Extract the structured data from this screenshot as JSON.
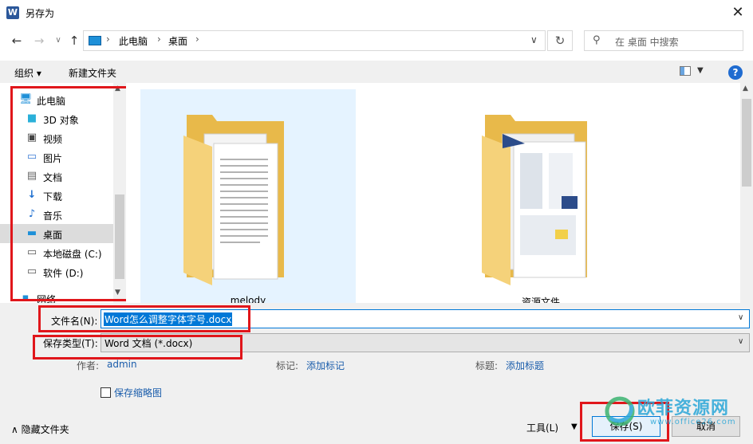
{
  "window": {
    "title": "另存为",
    "app_icon": "W",
    "close": "✕"
  },
  "nav": {
    "back": "←",
    "forward": "→",
    "recent": "∨",
    "up": "↑",
    "breadcrumbs": [
      "此电脑",
      "桌面"
    ],
    "refresh": "↻",
    "search_placeholder": "在 桌面 中搜索"
  },
  "toolbar": {
    "organize": "组织 ▾",
    "new_folder": "新建文件夹",
    "help": "?"
  },
  "sidebar": {
    "items": [
      {
        "label": "此电脑",
        "icon": "computer-icon"
      },
      {
        "label": "3D 对象",
        "icon": "cube-icon"
      },
      {
        "label": "视频",
        "icon": "video-icon"
      },
      {
        "label": "图片",
        "icon": "picture-icon"
      },
      {
        "label": "文档",
        "icon": "document-icon"
      },
      {
        "label": "下载",
        "icon": "download-icon"
      },
      {
        "label": "音乐",
        "icon": "music-icon"
      },
      {
        "label": "桌面",
        "icon": "desktop-icon",
        "selected": true
      },
      {
        "label": "本地磁盘 (C:)",
        "icon": "drive-icon"
      },
      {
        "label": "软件 (D:)",
        "icon": "drive-icon"
      },
      {
        "label": "网络",
        "icon": "network-icon"
      }
    ]
  },
  "content": {
    "folders": [
      {
        "name": "melody",
        "icon": "folder-documents-icon",
        "selected": true
      },
      {
        "name": "资源文件",
        "icon": "folder-images-icon"
      }
    ]
  },
  "form": {
    "filename_label": "文件名(N):",
    "filename_value": "Word怎么调整字体字号.docx",
    "filetype_label": "保存类型(T):",
    "filetype_value": "Word 文档 (*.docx)",
    "author_label": "作者:",
    "author_value": "admin",
    "tags_label": "标记:",
    "tags_value": "添加标记",
    "title_label": "标题:",
    "title_value": "添加标题",
    "thumbnail_label": "保存缩略图"
  },
  "footer": {
    "hide_folders": "∧  隐藏文件夹",
    "tools": "工具(L)",
    "save": "保存(S)",
    "cancel": "取消"
  },
  "watermark": {
    "text": "欧菲资源网",
    "sub": "www.office26.com"
  },
  "colors": {
    "accent": "#0078d7",
    "highlight": "#e0161b",
    "link": "#1a5dab"
  }
}
